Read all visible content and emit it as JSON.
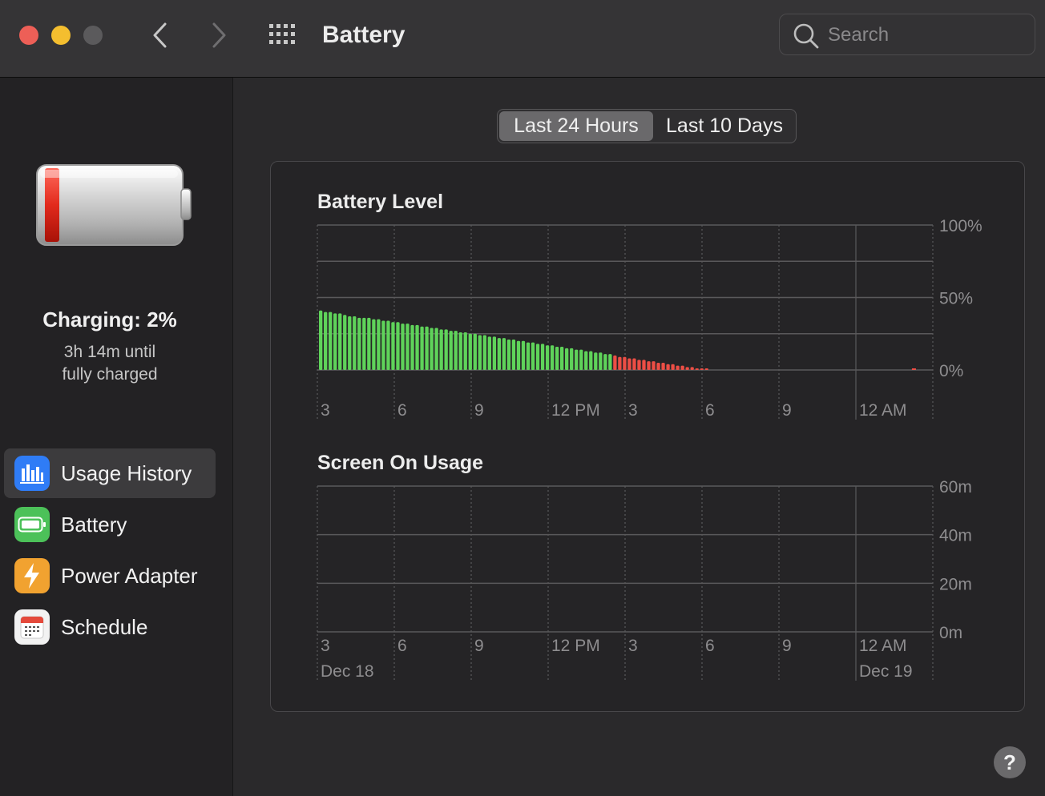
{
  "window": {
    "title": "Battery",
    "search_placeholder": "Search",
    "help_label": "?"
  },
  "sidebar": {
    "status": {
      "title": "Charging: 2%",
      "line1": "3h 14m until",
      "line2": "fully charged",
      "battery_level_pct": 2
    },
    "items": [
      {
        "label": "Usage History",
        "icon": "usage-history-icon",
        "color": "#2f7cf6",
        "active": true
      },
      {
        "label": "Battery",
        "icon": "battery-icon",
        "color": "#4cc159",
        "active": false
      },
      {
        "label": "Power Adapter",
        "icon": "power-adapter-icon",
        "color": "#f1a230",
        "active": false
      },
      {
        "label": "Schedule",
        "icon": "calendar-icon",
        "color": "#f2f2f2",
        "active": false
      }
    ]
  },
  "segmented": {
    "options": [
      "Last 24 Hours",
      "Last 10 Days"
    ],
    "selected": "Last 24 Hours"
  },
  "chart_data": [
    {
      "type": "bar",
      "title": "Battery Level",
      "y_ticks": [
        "100%",
        "50%",
        "0%"
      ],
      "ylim": [
        0,
        100
      ],
      "x_ticks": [
        "3",
        "6",
        "9",
        "12 PM",
        "3",
        "6",
        "9",
        "12 AM"
      ],
      "grid": true,
      "colors": {
        "normal": "#5fd35a",
        "low": "#ec4e45"
      },
      "series": [
        {
          "values": [
            41,
            40,
            40,
            39,
            39,
            38,
            37,
            37,
            36,
            36,
            36,
            35,
            35,
            34,
            34,
            33,
            33,
            32,
            32,
            31,
            31,
            30,
            30,
            29,
            29,
            28,
            28,
            27,
            27,
            26,
            26,
            25,
            25,
            24,
            24,
            23,
            23,
            22,
            22,
            21,
            21,
            20,
            20,
            19,
            19,
            18,
            18,
            17,
            17,
            16,
            16,
            15,
            15,
            14,
            14,
            13,
            13,
            12,
            12,
            11,
            11,
            10,
            9,
            9,
            8,
            8,
            7,
            7,
            6,
            6,
            5,
            5,
            4,
            4,
            3,
            3,
            2,
            2,
            1,
            1,
            1
          ],
          "low_threshold": 10
        }
      ],
      "late_point": {
        "x_fraction_of_day": 0.97,
        "value": 1
      }
    },
    {
      "type": "bar",
      "title": "Screen On Usage",
      "y_ticks": [
        "60m",
        "40m",
        "20m",
        "0m"
      ],
      "ylim": [
        0,
        60
      ],
      "x_ticks": [
        "3",
        "6",
        "9",
        "12 PM",
        "3",
        "6",
        "9",
        "12 AM"
      ],
      "x_dates": [
        "Dec 18",
        "Dec 19"
      ],
      "grid": true,
      "series": [
        {
          "values": []
        }
      ]
    }
  ]
}
